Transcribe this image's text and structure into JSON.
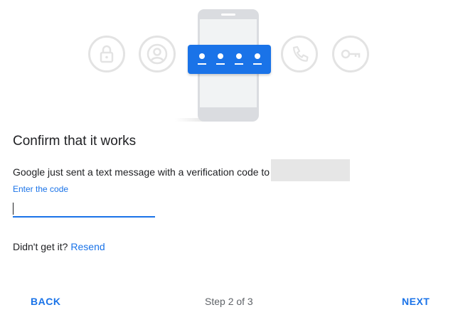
{
  "illustration": {
    "icons": [
      "lock-icon",
      "account-icon",
      "phone-call-icon",
      "key-icon"
    ],
    "code_digits": 4,
    "accent_color": "#1a73e8",
    "circle_color": "#e3e3e3"
  },
  "page": {
    "title": "Confirm that it works",
    "message": "Google just sent a text message with a verification code to",
    "field_label": "Enter the code",
    "code_value": "",
    "resend_prompt": "Didn't get it?",
    "resend_link": "Resend"
  },
  "footer": {
    "back_label": "BACK",
    "step_label": "Step 2 of 3",
    "next_label": "NEXT"
  }
}
